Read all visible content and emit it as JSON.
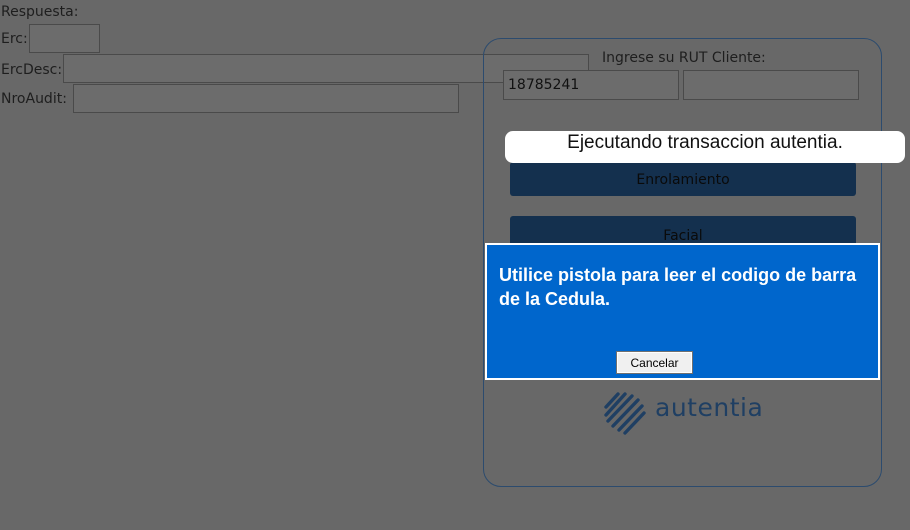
{
  "form": {
    "respuesta_label": "Respuesta:",
    "erc_label": "Erc:",
    "erc_value": "",
    "ercdesc_label": "ErcDesc:",
    "ercdesc_value": "",
    "nroaudit_label": "NroAudit:",
    "nroaudit_value": ""
  },
  "panel": {
    "rut_prompt": "Ingrese su RUT Cliente:",
    "rut_value": "18785241",
    "rut_dv_value": "",
    "enrolamiento_label": "Enrolamiento",
    "facial_label": "Facial",
    "brand": "autentia"
  },
  "toast": {
    "text": "Ejecutando transaccion autentia."
  },
  "dialog": {
    "message": "Utilice pistola para leer el codigo de barra de la Cedula.",
    "cancel_label": "Cancelar",
    "background": "#0066CC"
  }
}
